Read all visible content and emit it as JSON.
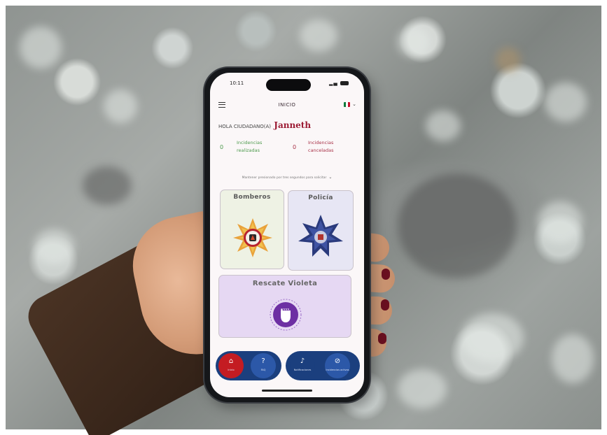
{
  "status": {
    "time": "10:11"
  },
  "header": {
    "title": "INICIO"
  },
  "greeting": {
    "prefix": "HOLA CIUDADANO(A)",
    "name": "Janneth"
  },
  "stats": [
    {
      "value": "0",
      "label": "Incidencias realizadas"
    },
    {
      "value": "0",
      "label": "Incidencias canceladas"
    }
  ],
  "hint": "Mantener presionado por tres segundos para solicitar",
  "cards": {
    "bomberos": "Bomberos",
    "policia": "Policía",
    "violeta": "Rescate Violeta"
  },
  "nav": {
    "home": "Inicio",
    "faq": "FAQ",
    "alerts": "Notificaciones",
    "cancel": "Incidencias activas"
  },
  "colors": {
    "accent_name": "#9c1b34",
    "nav_bg": "#1b3f7e",
    "home_button": "#c41c22",
    "violet_card": "#e6d8f3"
  },
  "icons": [
    "menu-icon",
    "flag-icon",
    "home-icon",
    "help-icon",
    "bell-icon",
    "cancel-icon",
    "fire-badge-icon",
    "police-badge-icon",
    "violet-fist-icon"
  ]
}
